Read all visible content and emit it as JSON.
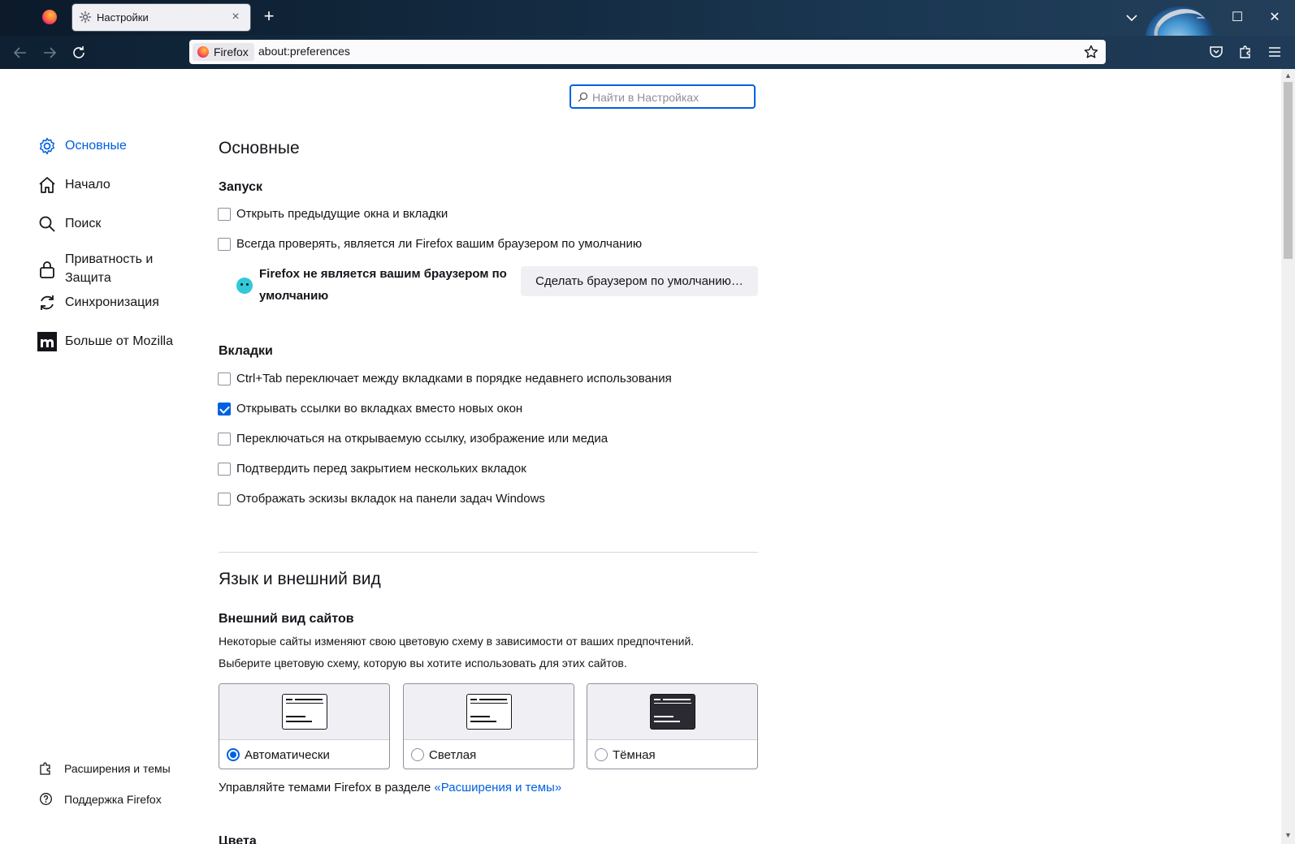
{
  "window": {
    "tab_title": "Настройки",
    "tab_close": "×",
    "new_tab": "+",
    "minimize": "–",
    "maximize": "☐",
    "close": "✕"
  },
  "navbar": {
    "identity_label": "Firefox",
    "url": "about:preferences"
  },
  "search": {
    "placeholder": "Найти в Настройках",
    "value": ""
  },
  "sidebar": {
    "categories": [
      {
        "label": "Основные",
        "icon": "gear-icon",
        "selected": true
      },
      {
        "label": "Начало",
        "icon": "home-icon"
      },
      {
        "label": "Поиск",
        "icon": "search-icon"
      },
      {
        "label": "Приватность и Защита",
        "icon": "lock-icon"
      },
      {
        "label": "Синхронизация",
        "icon": "sync-icon"
      },
      {
        "label": "Больше от Mozilla",
        "icon": "mozilla-icon"
      }
    ],
    "footer": [
      {
        "label": "Расширения и темы",
        "icon": "puzzle-icon"
      },
      {
        "label": "Поддержка Firefox",
        "icon": "help-icon"
      }
    ]
  },
  "main": {
    "title": "Основные",
    "startup": {
      "heading": "Запуск",
      "items": [
        {
          "label": "Открыть предыдущие окна и вкладки",
          "checked": false
        },
        {
          "label": "Всегда проверять, является ли Firefox вашим браузером по умолчанию",
          "checked": false
        }
      ],
      "default_notice": "Firefox не является вашим браузером по умолчанию",
      "default_button": "Сделать браузером по умолчанию…"
    },
    "tabs": {
      "heading": "Вкладки",
      "items": [
        {
          "label": "Ctrl+Tab переключает между вкладками в порядке недавнего использования",
          "checked": false
        },
        {
          "label": "Открывать ссылки во вкладках вместо новых окон",
          "checked": true
        },
        {
          "label": "Переключаться на открываемую ссылку, изображение или медиа",
          "checked": false
        },
        {
          "label": "Подтвердить перед закрытием нескольких вкладок",
          "checked": false
        },
        {
          "label": "Отображать эскизы вкладок на панели задач Windows",
          "checked": false
        }
      ]
    },
    "language": {
      "title": "Язык и внешний вид",
      "appearance_heading": "Внешний вид сайтов",
      "desc1": "Некоторые сайты изменяют свою цветовую схему в зависимости от ваших предпочтений.",
      "desc2": "Выберите цветовую схему, которую вы хотите использовать для этих сайтов.",
      "schemes": [
        {
          "label": "Автоматически",
          "selected": true
        },
        {
          "label": "Светлая",
          "selected": false
        },
        {
          "label": "Тёмная",
          "selected": false
        }
      ],
      "themes_text": "Управляйте темами Firefox в разделе ",
      "themes_link": "«Расширения и темы»",
      "next_heading": "Цвета"
    }
  },
  "colors": {
    "accent": "#0061e0",
    "text": "#15141a",
    "frame": "#132a40"
  }
}
